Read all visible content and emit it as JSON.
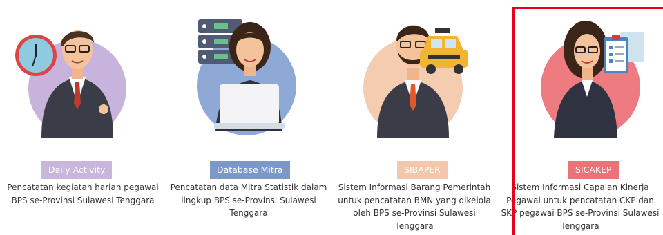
{
  "cards": [
    {
      "badge": "Daily Activity",
      "badge_color": "#c9b6dc",
      "circle_color": "#c8b3dc",
      "description": "Pencatatan kegiatan harian pegawai BPS se-Provinsi Sulawesi Tenggara",
      "icon": "clock-icon"
    },
    {
      "badge": "Database Mitra",
      "badge_color": "#7b98c9",
      "circle_color": "#8fa9d6",
      "description": "Pencatatan data Mitra Statistik dalam lingkup BPS se-Provinsi Sulawesi Tenggara",
      "icon": "database-icon"
    },
    {
      "badge": "SIBAPER",
      "badge_color": "#f3c7ab",
      "circle_color": "#f4cdb1",
      "description": "Sistem Informasi Barang Pemerintah untuk pencatatan BMN yang dikelola oleh BPS se-Provinsi Sulawesi Tenggara",
      "icon": "taxi-icon"
    },
    {
      "badge": "SICAKEP",
      "badge_color": "#e8747a",
      "circle_color": "#ee7b80",
      "description": "Sistem Informasi Capaian Kinerja Pegawai untuk pencatatan CKP dan SKP pegawai BPS se-Provinsi Sulawesi Tenggara",
      "icon": "clipboard-icon"
    }
  ]
}
